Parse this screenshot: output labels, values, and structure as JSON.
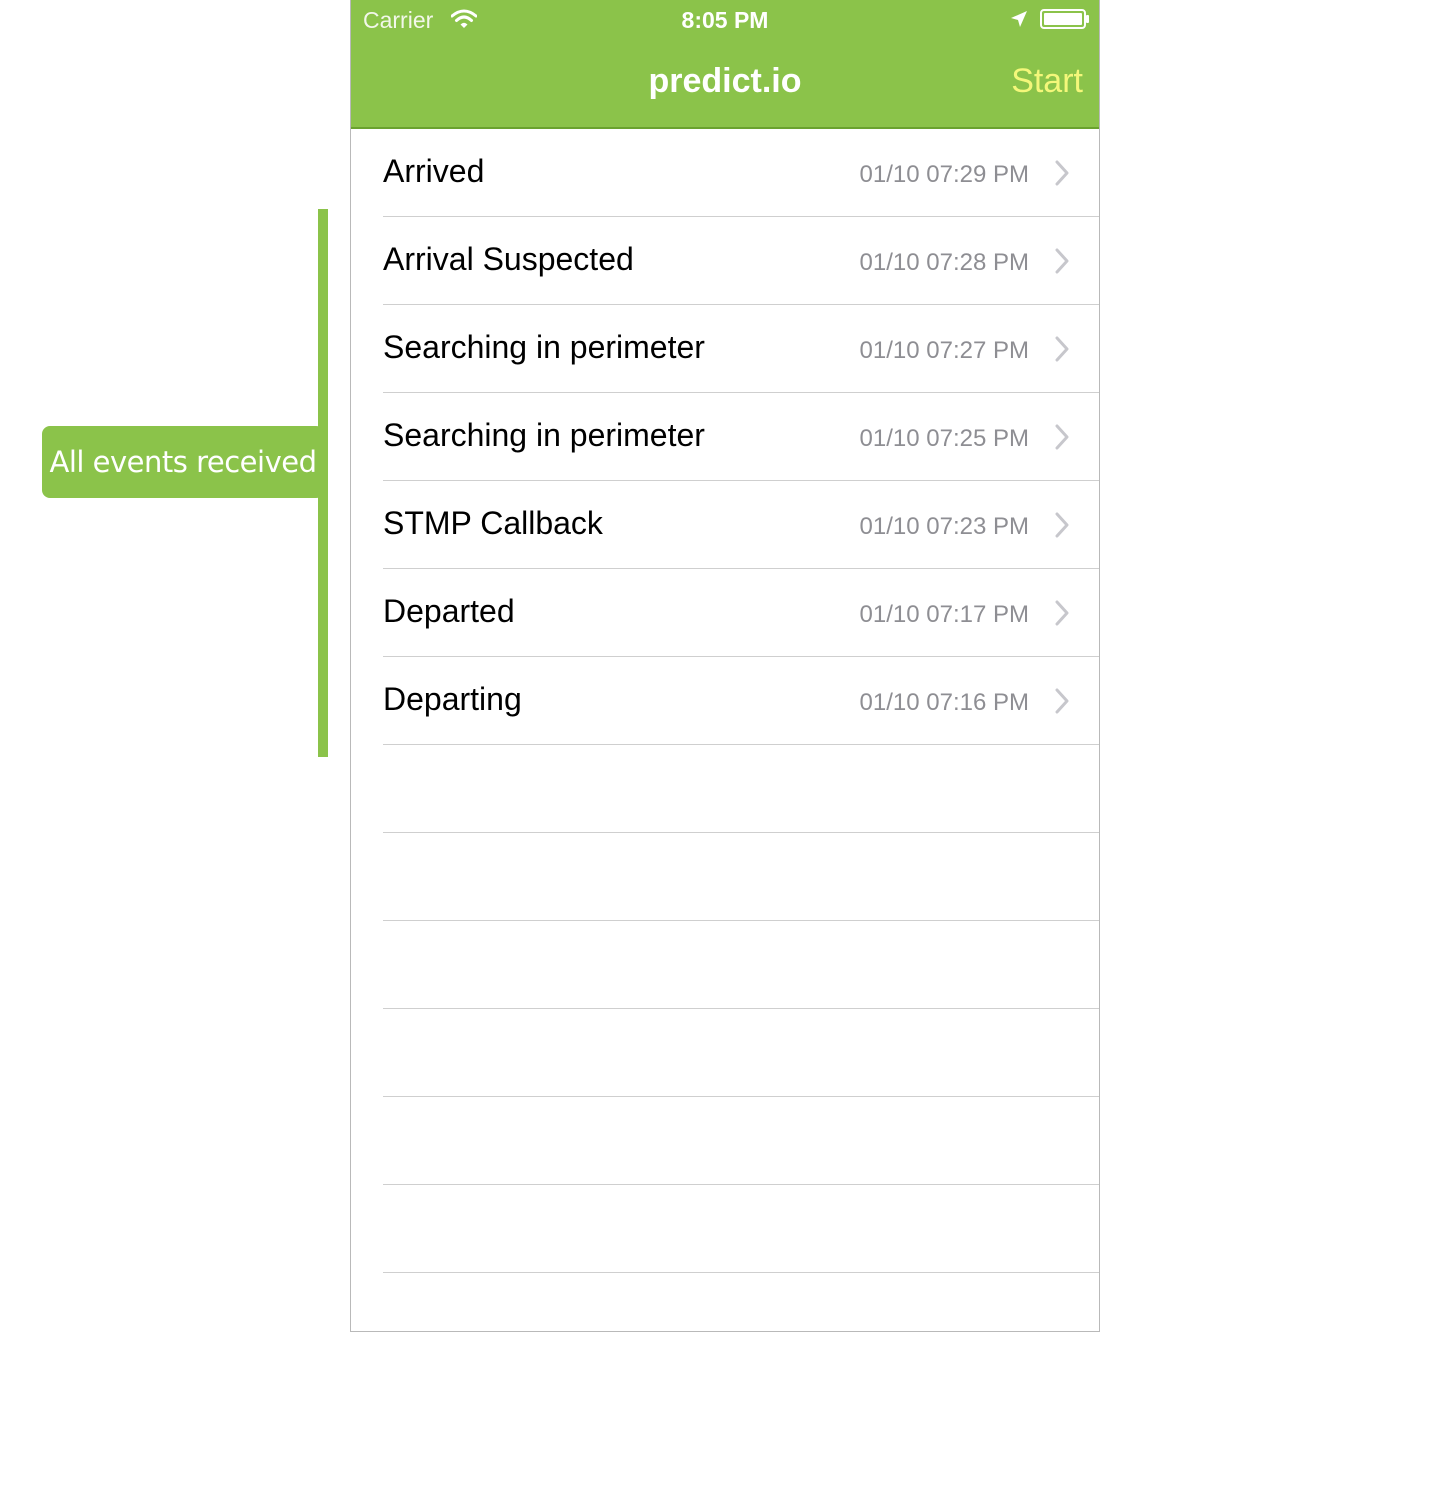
{
  "annotation": {
    "label": "All events received",
    "color": "#8bc34a"
  },
  "status_bar": {
    "carrier": "Carrier",
    "time": "8:05 PM",
    "icons": [
      "wifi-icon",
      "location-arrow-icon",
      "battery-icon"
    ]
  },
  "nav": {
    "title": "predict.io",
    "start_label": "Start",
    "bar_color": "#8bc34a",
    "start_color": "#f4f77a"
  },
  "events": [
    {
      "title": "Arrived",
      "time": "01/10 07:29 PM"
    },
    {
      "title": "Arrival Suspected",
      "time": "01/10 07:28 PM"
    },
    {
      "title": "Searching in perimeter",
      "time": "01/10 07:27 PM"
    },
    {
      "title": "Searching in perimeter",
      "time": "01/10 07:25 PM"
    },
    {
      "title": "STMP Callback",
      "time": "01/10 07:23 PM"
    },
    {
      "title": "Departed",
      "time": "01/10 07:17 PM"
    },
    {
      "title": "Departing",
      "time": "01/10 07:16 PM"
    }
  ]
}
